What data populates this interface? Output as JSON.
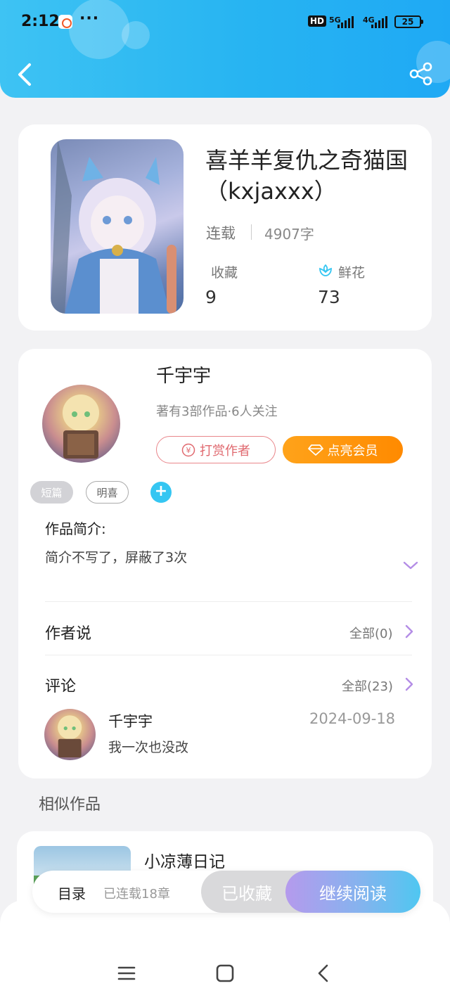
{
  "status_bar": {
    "time": "2:12",
    "more": "···",
    "network1": "5G",
    "network2": "4G",
    "hd": "HD",
    "battery": "25"
  },
  "book": {
    "title": "喜羊羊复仇之奇猫国（kxjaxxx）",
    "status": "连载",
    "word_count": "4907字",
    "stats": [
      {
        "label": "收藏",
        "value": "9"
      },
      {
        "label": "鲜花",
        "value": "73"
      }
    ]
  },
  "author": {
    "name": "千宇宇",
    "meta": "著有3部作品·6人关注",
    "tip_button": "打赏作者",
    "vip_button": "点亮会员"
  },
  "tags": [
    "短篇",
    "明喜"
  ],
  "intro": {
    "heading": "作品简介:",
    "text": "简介不写了，屏蔽了3次"
  },
  "author_says": {
    "title": "作者说",
    "all": "全部(0)"
  },
  "comments": {
    "title": "评论",
    "all": "全部(23)",
    "items": [
      {
        "name": "千宇宇",
        "date": "2024-09-18",
        "text": "我一次也没改"
      }
    ]
  },
  "similar": {
    "title": "相似作品",
    "items": [
      {
        "name": "小凉薄日记"
      }
    ]
  },
  "action_bar": {
    "toc": "目录",
    "chapters": "已连载18章",
    "favorited": "已收藏",
    "continue": "继续阅读"
  },
  "colors": {
    "accent": "#27b4f2",
    "vip": "#ff8a00",
    "tip": "#e0696f"
  }
}
